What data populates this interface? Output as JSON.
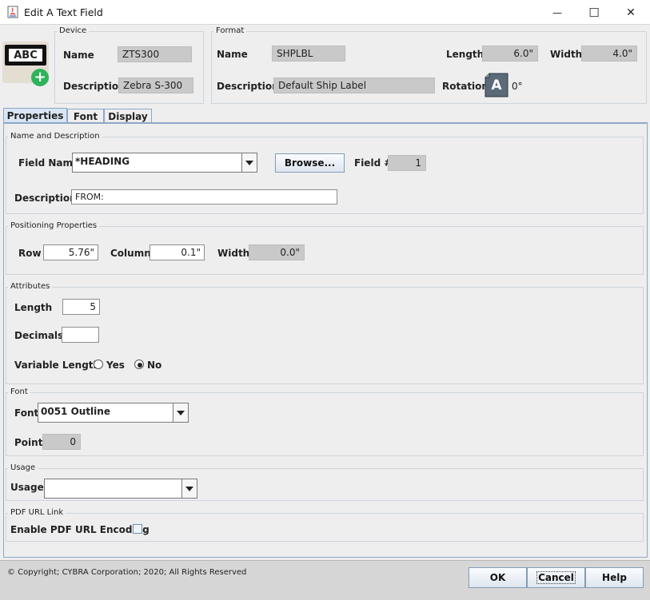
{
  "window": {
    "title": "Edit A Text Field",
    "minimize_glyph": "—",
    "maximize_glyph": "☐",
    "close_glyph": "✕"
  },
  "device_icon": {
    "text": "ABC",
    "badge": "+"
  },
  "device": {
    "group_title": "Device",
    "name_label": "Name",
    "name_value": "ZTS300",
    "description_label": "Description",
    "description_value": "Zebra S-300"
  },
  "format": {
    "group_title": "Format",
    "name_label": "Name",
    "name_value": "SHPLBL",
    "description_label": "Description",
    "description_value": "Default Ship Label",
    "length_label": "Length",
    "length_value": "6.0\"",
    "width_label": "Width",
    "width_value": "4.0\"",
    "rotation_label": "Rotation",
    "rotation_icon_letter": "A",
    "rotation_value": "0°"
  },
  "tabs": [
    {
      "label": "Properties",
      "active": true
    },
    {
      "label": "Font",
      "active": false
    },
    {
      "label": "Display",
      "active": false
    }
  ],
  "name_description": {
    "group_title": "Name and Description",
    "field_name_label": "Field Name",
    "field_name_value": "*HEADING",
    "browse_label": "Browse...",
    "field_num_label": "Field #",
    "field_num_value": "1",
    "description_label": "Description",
    "description_value": "FROM:"
  },
  "positioning": {
    "group_title": "Positioning Properties",
    "row_label": "Row",
    "row_value": "5.76\"",
    "column_label": "Column",
    "column_value": "0.1\"",
    "width_label": "Width",
    "width_value": "0.0\""
  },
  "attributes": {
    "group_title": "Attributes",
    "length_label": "Length",
    "length_value": "5",
    "decimals_label": "Decimals",
    "decimals_value": "",
    "variable_length_label": "Variable Length",
    "yes_label": "Yes",
    "no_label": "No",
    "selected": "No"
  },
  "font": {
    "group_title": "Font",
    "font_label": "Font",
    "font_value": "0051 Outline",
    "point_label": "Point",
    "point_value": "0"
  },
  "usage": {
    "group_title": "Usage",
    "usage_label": "Usage",
    "usage_value": ""
  },
  "pdf": {
    "group_title": "PDF URL Link",
    "enable_label": "Enable PDF URL Encoding",
    "checked": false
  },
  "footer": {
    "copyright": "© Copyright; CYBRA Corporation; 2020; All Rights Reserved",
    "ok_label": "OK",
    "cancel_label": "Cancel",
    "help_label": "Help"
  },
  "colors": {
    "window_bg": "#eeeeee",
    "readonly_bg": "#c9c9c9",
    "tab_active_bg": "#d9e6f5",
    "button_border": "#7f9db9",
    "badge_green": "#2fb35a"
  }
}
